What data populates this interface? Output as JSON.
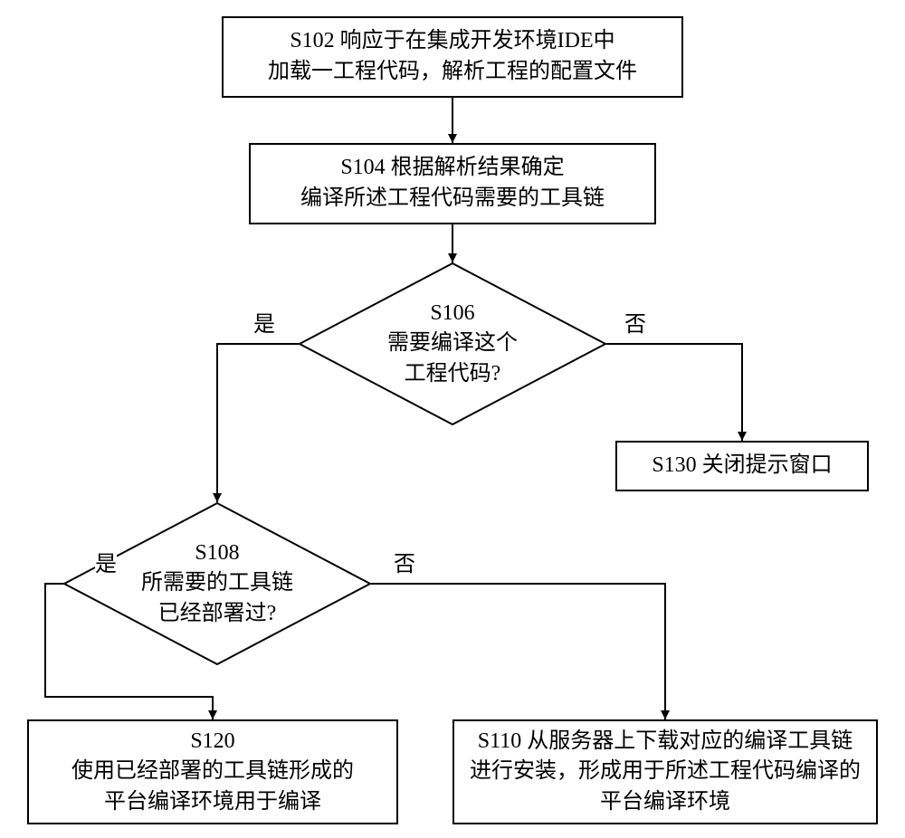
{
  "nodes": {
    "s102": {
      "line1": "S102  响应于在集成开发环境IDE中",
      "line2": "加载一工程代码，解析工程的配置文件"
    },
    "s104": {
      "line1": "S104  根据解析结果确定",
      "line2": "编译所述工程代码需要的工具链"
    },
    "s106": {
      "line1": "S106",
      "line2": "需要编译这个",
      "line3": "工程代码?"
    },
    "s108": {
      "line1": "S108",
      "line2": "所需要的工具链",
      "line3": "已经部署过?"
    },
    "s130": {
      "text": "S130  关闭提示窗口"
    },
    "s120": {
      "line1": "S120",
      "line2": "使用已经部署的工具链形成的",
      "line3": "平台编译环境用于编译"
    },
    "s110": {
      "line1": "S110  从服务器上下载对应的编译工具链",
      "line2": "进行安装，形成用于所述工程代码编译的",
      "line3": "平台编译环境"
    }
  },
  "labels": {
    "yes": "是",
    "no": "否"
  }
}
